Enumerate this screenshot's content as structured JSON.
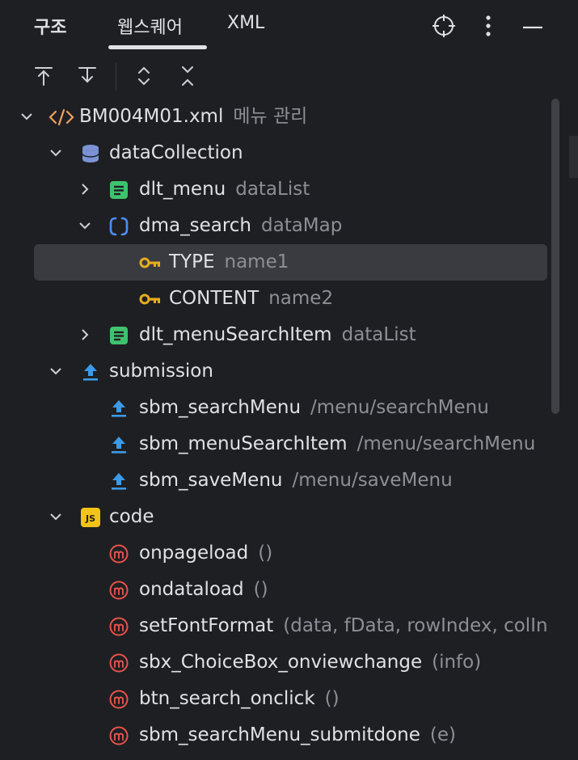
{
  "header": {
    "tabs": [
      {
        "label": "구조",
        "active": false
      },
      {
        "label": "웹스퀘어",
        "active": true
      },
      {
        "label": "XML",
        "active": false
      }
    ],
    "actions": [
      "target-icon",
      "more-vertical-icon",
      "minimize-icon"
    ]
  },
  "toolbar": {
    "actions": [
      "scroll-to-top-icon",
      "scroll-to-bottom-icon",
      "expand-all-icon",
      "collapse-all-icon"
    ]
  },
  "tree": {
    "root": {
      "name": "BM004M01.xml",
      "desc": "메뉴 관리"
    },
    "dataCollection": {
      "name": "dataCollection"
    },
    "dlt_menu": {
      "name": "dlt_menu",
      "desc": "dataList"
    },
    "dma_search": {
      "name": "dma_search",
      "desc": "dataMap"
    },
    "type": {
      "name": "TYPE",
      "desc": "name1"
    },
    "content": {
      "name": "CONTENT",
      "desc": "name2"
    },
    "dlt_menuSearchItem": {
      "name": "dlt_menuSearchItem",
      "desc": "dataList"
    },
    "submission": {
      "name": "submission"
    },
    "sbm_searchMenu": {
      "name": "sbm_searchMenu",
      "desc": "/menu/searchMenu"
    },
    "sbm_menuSearchItem": {
      "name": "sbm_menuSearchItem",
      "desc": "/menu/searchMenu"
    },
    "sbm_saveMenu": {
      "name": "sbm_saveMenu",
      "desc": "/menu/saveMenu"
    },
    "code": {
      "name": "code",
      "badge": "JS"
    },
    "onpageload": {
      "name": "onpageload",
      "desc": "()"
    },
    "ondataload": {
      "name": "ondataload",
      "desc": "()"
    },
    "setFontFormat": {
      "name": "setFontFormat",
      "desc": "(data, fData, rowIndex, colIn"
    },
    "sbx_ChoiceBox_onviewchange": {
      "name": "sbx_ChoiceBox_onviewchange",
      "desc": "(info)"
    },
    "btn_search_onclick": {
      "name": "btn_search_onclick",
      "desc": "()"
    },
    "sbm_searchMenu_submitdone": {
      "name": "sbm_searchMenu_submitdone",
      "desc": "(e)"
    },
    "selected_item": "TYPE"
  },
  "colors": {
    "background": "#1e1f22",
    "selection": "#393b40",
    "text": "#dfe1e5",
    "secondary_text": "#8c8f96",
    "xml_tag": "#f0a05a",
    "database": "#7b93d6",
    "list": "#3fc26e",
    "map": "#4d8df6",
    "key": "#e6ad1f",
    "submission": "#3c9ae8",
    "js_badge": "#f2c318",
    "method": "#e5534b"
  }
}
